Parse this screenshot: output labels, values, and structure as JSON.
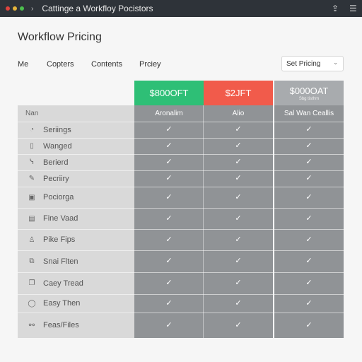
{
  "window": {
    "title": "Cattinge a Workfloy Pocistors"
  },
  "page": {
    "title": "Workflow Pricing"
  },
  "tabs": [
    "Me",
    "Copters",
    "Contents",
    "Prciey"
  ],
  "select": {
    "value": "Set Pricing"
  },
  "table": {
    "name_header": "Nan",
    "tiers": [
      {
        "price": "$800OFT",
        "sub": "",
        "label": "Aronalim",
        "color": "#2ebf76"
      },
      {
        "price": "$2JFT",
        "sub": "",
        "label": "Alio",
        "color": "#f15b4b"
      },
      {
        "price": "$000OAT",
        "sub": "Sbg tisthm",
        "label": "Sal Wan Ceallis",
        "color": "#a8abae"
      }
    ],
    "rows": [
      {
        "label": "Seriings",
        "icon": "gauge-icon",
        "glyph": "◔",
        "checks": [
          true,
          true,
          true
        ]
      },
      {
        "label": "Wanged",
        "icon": "phone-icon",
        "glyph": "▯",
        "checks": [
          true,
          true,
          true
        ]
      },
      {
        "label": "Berierd",
        "icon": "wrench-icon",
        "glyph": "ᓭ",
        "checks": [
          true,
          true,
          true
        ]
      },
      {
        "label": "Pecriiry",
        "icon": "pen-icon",
        "glyph": "✎",
        "checks": [
          true,
          true,
          true
        ]
      },
      {
        "label": "Pociorga",
        "icon": "image-icon",
        "glyph": "▣",
        "checks": [
          true,
          true,
          true
        ]
      },
      {
        "label": "Fine Vaad",
        "icon": "document-icon",
        "glyph": "▤",
        "checks": [
          true,
          true,
          true
        ]
      },
      {
        "label": "Pike Fips",
        "icon": "user-icon",
        "glyph": "♙",
        "checks": [
          true,
          true,
          true
        ]
      },
      {
        "label": "Snai Flten",
        "icon": "images-icon",
        "glyph": "⧉",
        "checks": [
          true,
          true,
          true
        ]
      },
      {
        "label": "Caey Tread",
        "icon": "files-icon",
        "glyph": "❐",
        "checks": [
          true,
          true,
          true
        ]
      },
      {
        "label": "Easy Then",
        "icon": "chat-icon",
        "glyph": "◯",
        "checks": [
          true,
          true,
          true
        ]
      },
      {
        "label": "Feas/Files",
        "icon": "share-icon",
        "glyph": "⚯",
        "checks": [
          true,
          true,
          true
        ]
      }
    ]
  }
}
